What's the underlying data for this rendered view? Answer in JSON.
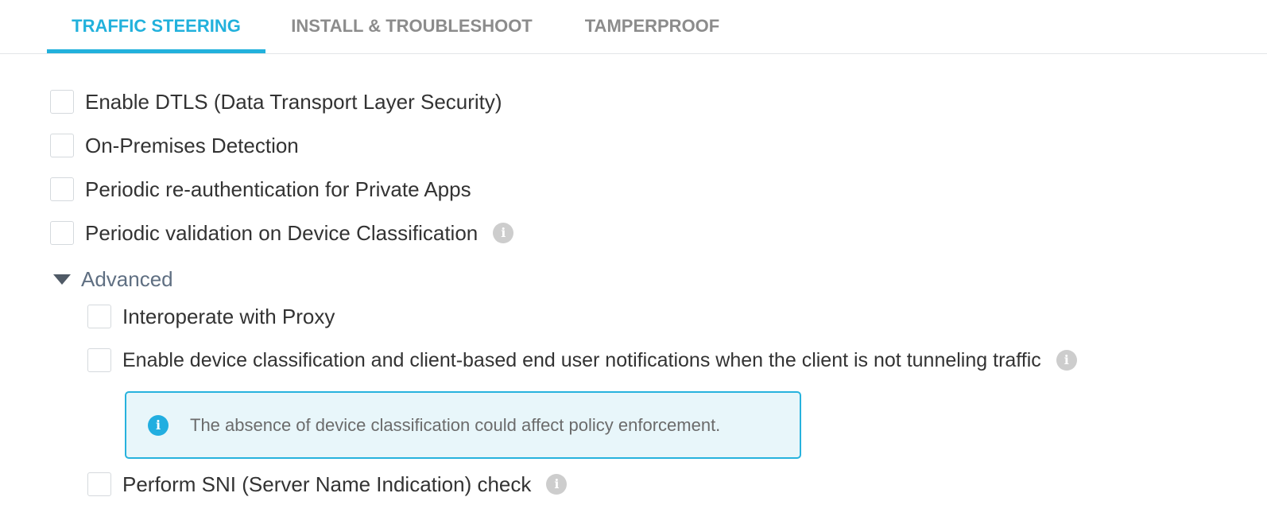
{
  "tabs": [
    {
      "label": "TRAFFIC STEERING",
      "active": true
    },
    {
      "label": "INSTALL & TROUBLESHOOT",
      "active": false
    },
    {
      "label": "TAMPERPROOF",
      "active": false
    }
  ],
  "options": [
    {
      "label": "Enable DTLS (Data Transport Layer Security)",
      "checked": false
    },
    {
      "label": "On-Premises Detection",
      "checked": false
    },
    {
      "label": "Periodic re-authentication for Private Apps",
      "checked": false
    },
    {
      "label": "Periodic validation on Device Classification",
      "checked": false,
      "info_icon": "info-icon"
    }
  ],
  "advanced": {
    "label": "Advanced",
    "expanded": true,
    "options": [
      {
        "label": "Interoperate with Proxy",
        "checked": false
      },
      {
        "label": "Enable device classification and client-based end user notifications when the client is not tunneling traffic",
        "checked": false,
        "info_icon": "info-icon"
      },
      {
        "label": "Perform SNI (Server Name Indication) check",
        "checked": false,
        "info_icon": "info-icon"
      }
    ],
    "notice": {
      "icon": "info-icon",
      "text": "The absence of device classification could affect policy enforcement."
    }
  },
  "colors": {
    "accent": "#22b1dc",
    "inactive_tab": "#8c8c8c",
    "advanced_label": "#5f6f82",
    "notice_border": "#27b2dd",
    "notice_background": "#e8f6fa",
    "info_icon_gray": "#cdcdcd"
  }
}
